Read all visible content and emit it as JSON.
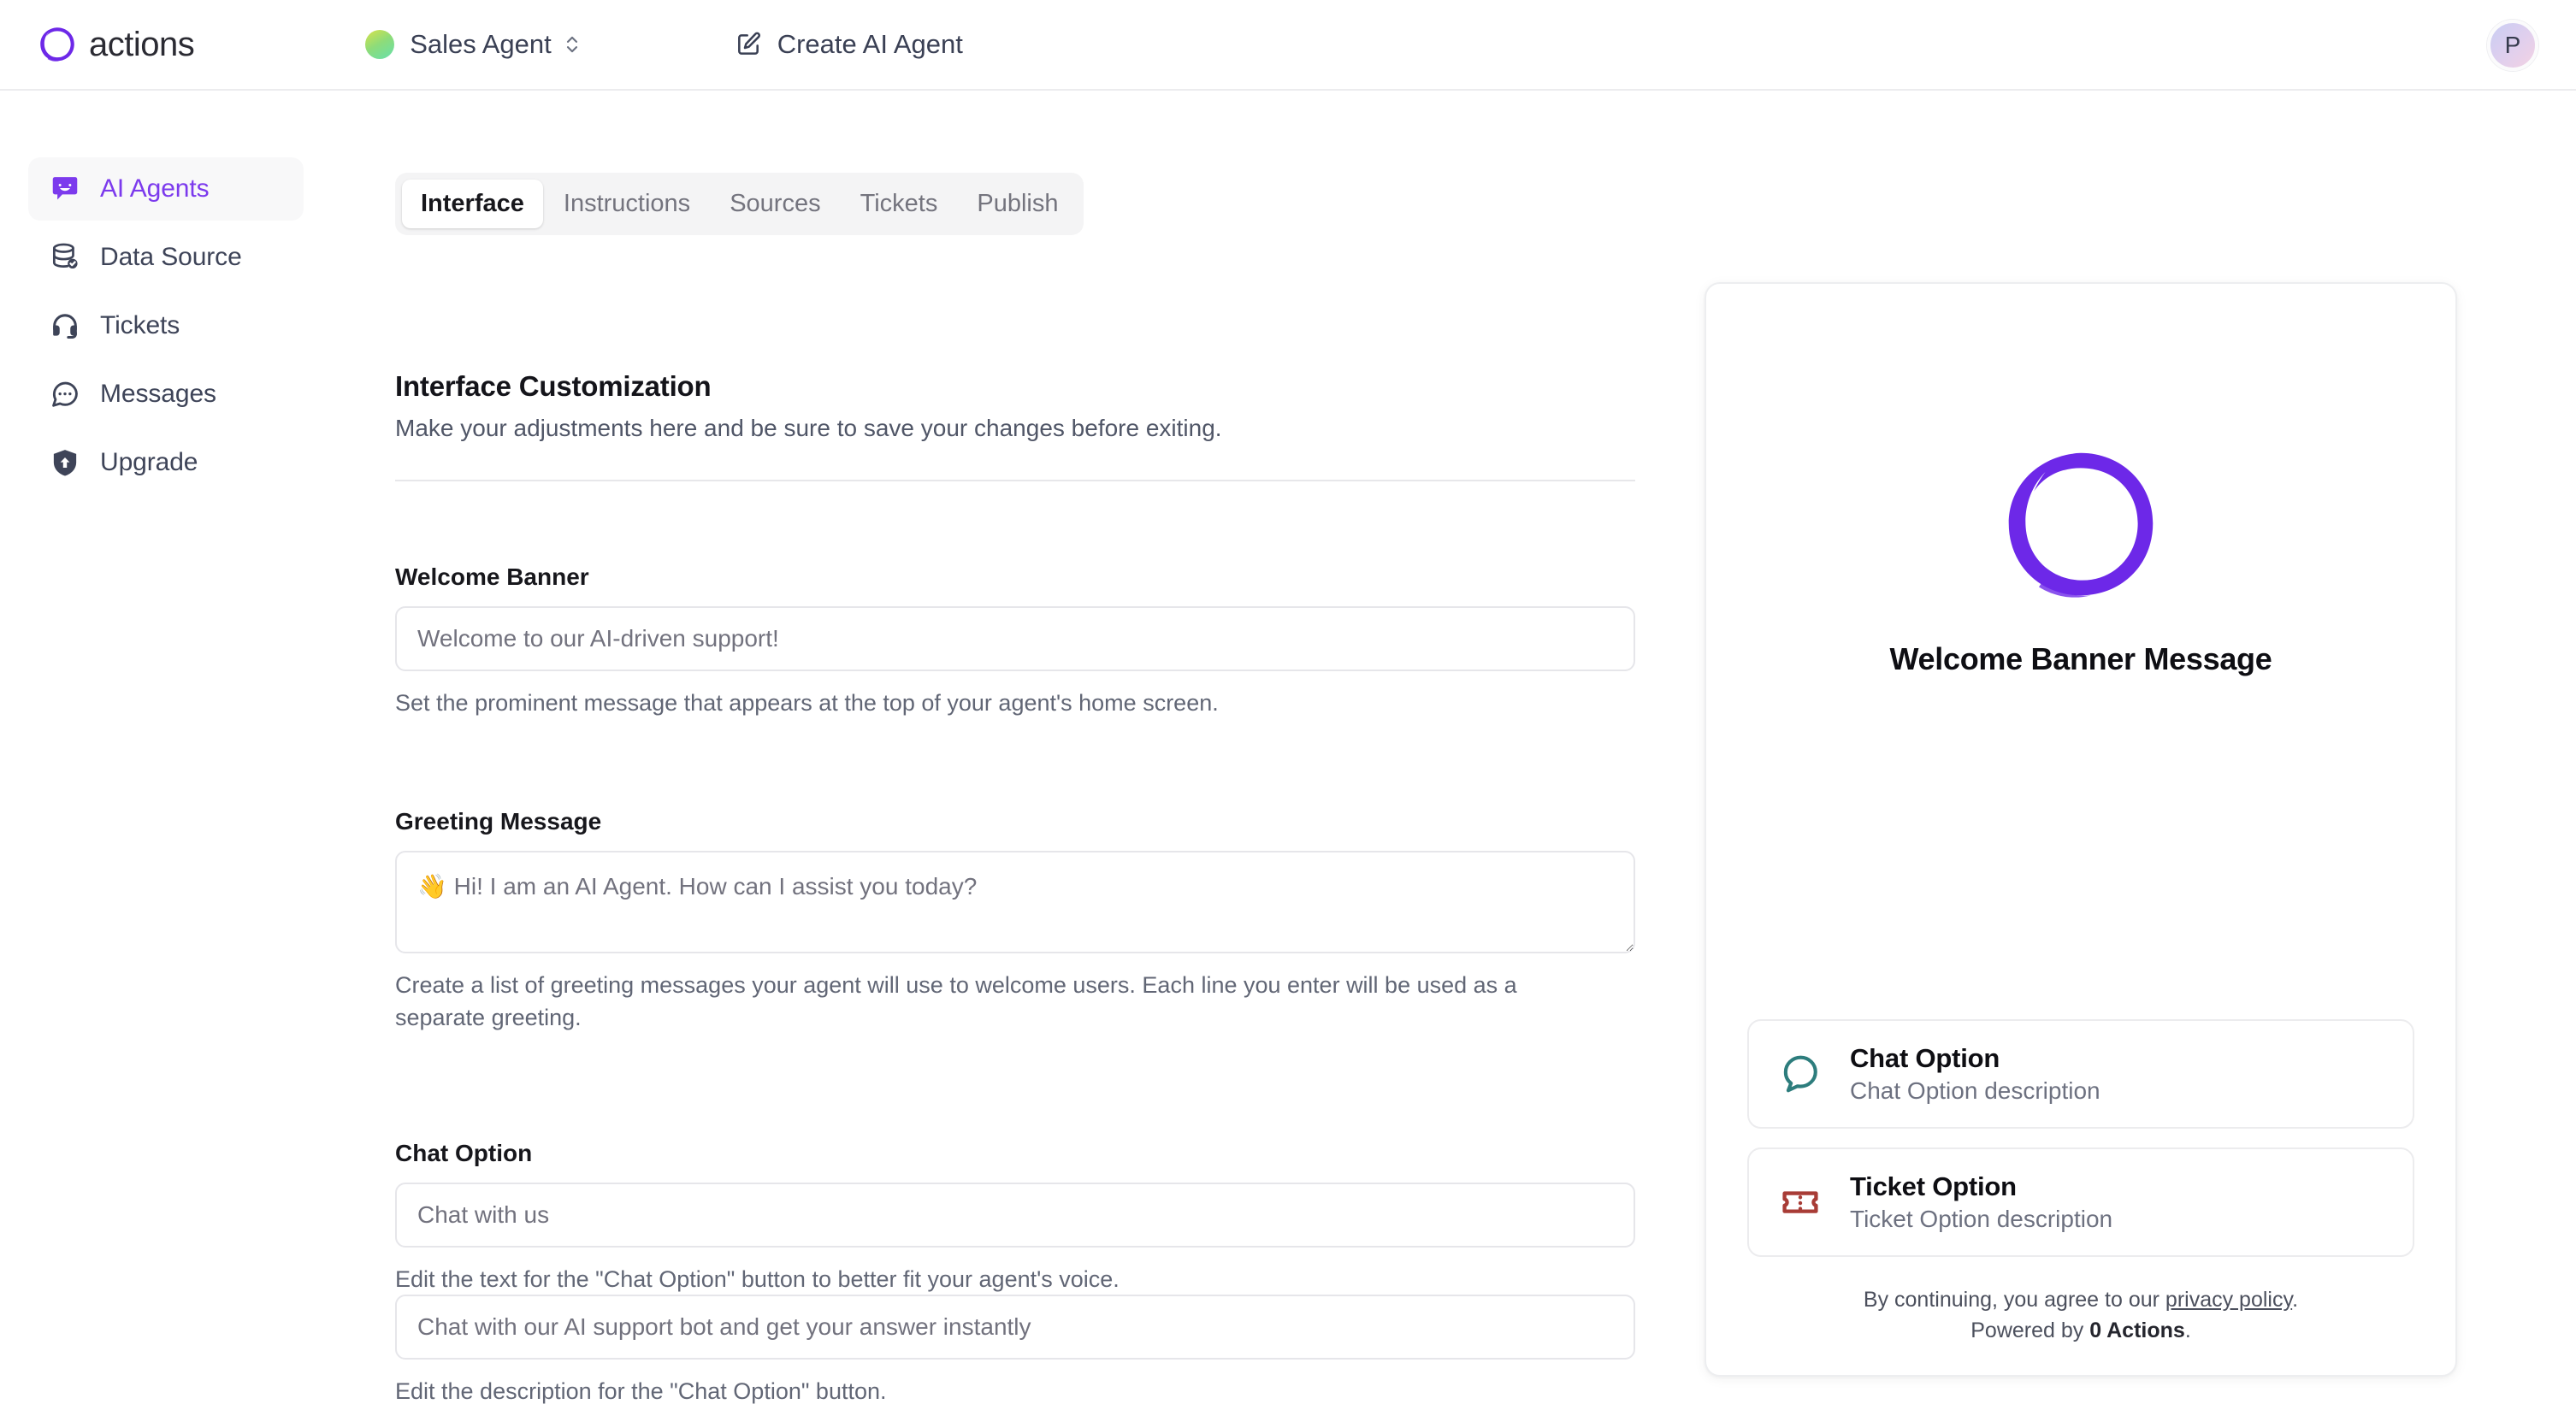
{
  "brand": {
    "name": "actions",
    "logo_icon": "brush-circle-logo",
    "accent": "#6d28e8"
  },
  "header": {
    "agent_selector": {
      "name": "Sales Agent",
      "dot_colors": [
        "#d9e24a",
        "#66e0ac"
      ],
      "chevron_icon": "chevron-up-down-icon"
    },
    "create_agent": {
      "label": "Create AI Agent",
      "icon": "square-pencil-icon"
    },
    "avatar": {
      "initial": "P"
    }
  },
  "sidebar": {
    "items": [
      {
        "label": "AI Agents",
        "icon": "chat-bot-icon",
        "active": true
      },
      {
        "label": "Data Source",
        "icon": "database-check-icon",
        "active": false
      },
      {
        "label": "Tickets",
        "icon": "headset-icon",
        "active": false
      },
      {
        "label": "Messages",
        "icon": "chat-dots-icon",
        "active": false
      },
      {
        "label": "Upgrade",
        "icon": "shield-up-icon",
        "active": false
      }
    ]
  },
  "tabs": [
    {
      "label": "Interface",
      "active": true
    },
    {
      "label": "Instructions",
      "active": false
    },
    {
      "label": "Sources",
      "active": false
    },
    {
      "label": "Tickets",
      "active": false
    },
    {
      "label": "Publish",
      "active": false
    }
  ],
  "main": {
    "title": "Interface Customization",
    "subtitle": "Make your adjustments here and be sure to save your changes before exiting.",
    "fields": {
      "welcome_banner": {
        "label": "Welcome Banner",
        "value": "",
        "placeholder": "Welcome to our AI-driven support!",
        "help": "Set the prominent message that appears at the top of your agent's home screen."
      },
      "greeting_message": {
        "label": "Greeting Message",
        "value": "",
        "placeholder": "👋 Hi! I am an AI Agent. How can I assist you today?",
        "help": "Create a list of greeting messages your agent will use to welcome users. Each line you enter will be used as a separate greeting."
      },
      "chat_option": {
        "label": "Chat Option",
        "title_value": "",
        "title_placeholder": "Chat with us",
        "title_help": "Edit the text for the \"Chat Option\" button to better fit your agent's voice.",
        "desc_value": "",
        "desc_placeholder": "Chat with our AI support bot and get your answer instantly",
        "desc_help": "Edit the description for the \"Chat Option\" button."
      }
    }
  },
  "preview": {
    "logo_icon": "brush-circle-logo",
    "banner": "Welcome Banner Message",
    "options": [
      {
        "title": "Chat Option",
        "desc": "Chat Option description",
        "icon": "chat-bubble-icon",
        "color": "#2d7d7d"
      },
      {
        "title": "Ticket Option",
        "desc": "Ticket Option description",
        "icon": "ticket-icon",
        "color": "#a83c36"
      }
    ],
    "footer": {
      "consent_prefix": "By continuing, you agree to our ",
      "privacy_link": "privacy policy",
      "consent_suffix": ".",
      "powered_prefix": "Powered by ",
      "powered_brand": "0 Actions",
      "powered_suffix": "."
    }
  }
}
